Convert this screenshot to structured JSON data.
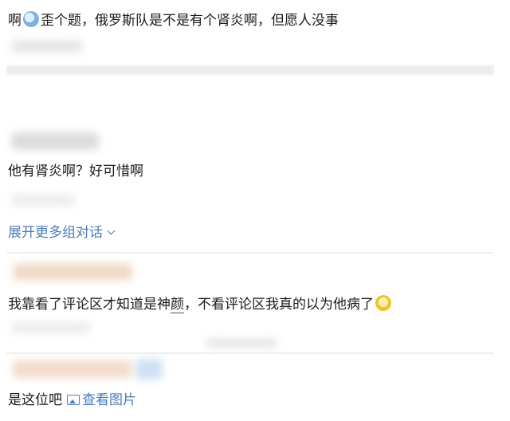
{
  "comments": [
    {
      "prefix": "啊",
      "text": "歪个题，俄罗斯队是不是有个肾炎啊，但愿人没事"
    },
    {
      "text": "他有肾炎啊？好可惜啊"
    },
    {
      "pre": "我靠看了评论区才知道是神",
      "highlight": "颜",
      "post": "，不看评论区我真的以为他病了"
    },
    {
      "text": "是这位吧"
    }
  ],
  "expand_replies": {
    "label": "展开更多组对话"
  },
  "view_image": {
    "label": "查看图片"
  },
  "icons": [
    "face-emoji-icon",
    "chevron-down-icon",
    "laughing-emoji-icon",
    "picture-icon"
  ],
  "colors": {
    "link": "#4a7bbd",
    "text": "#1a1a1a",
    "separator": "#efefef"
  }
}
